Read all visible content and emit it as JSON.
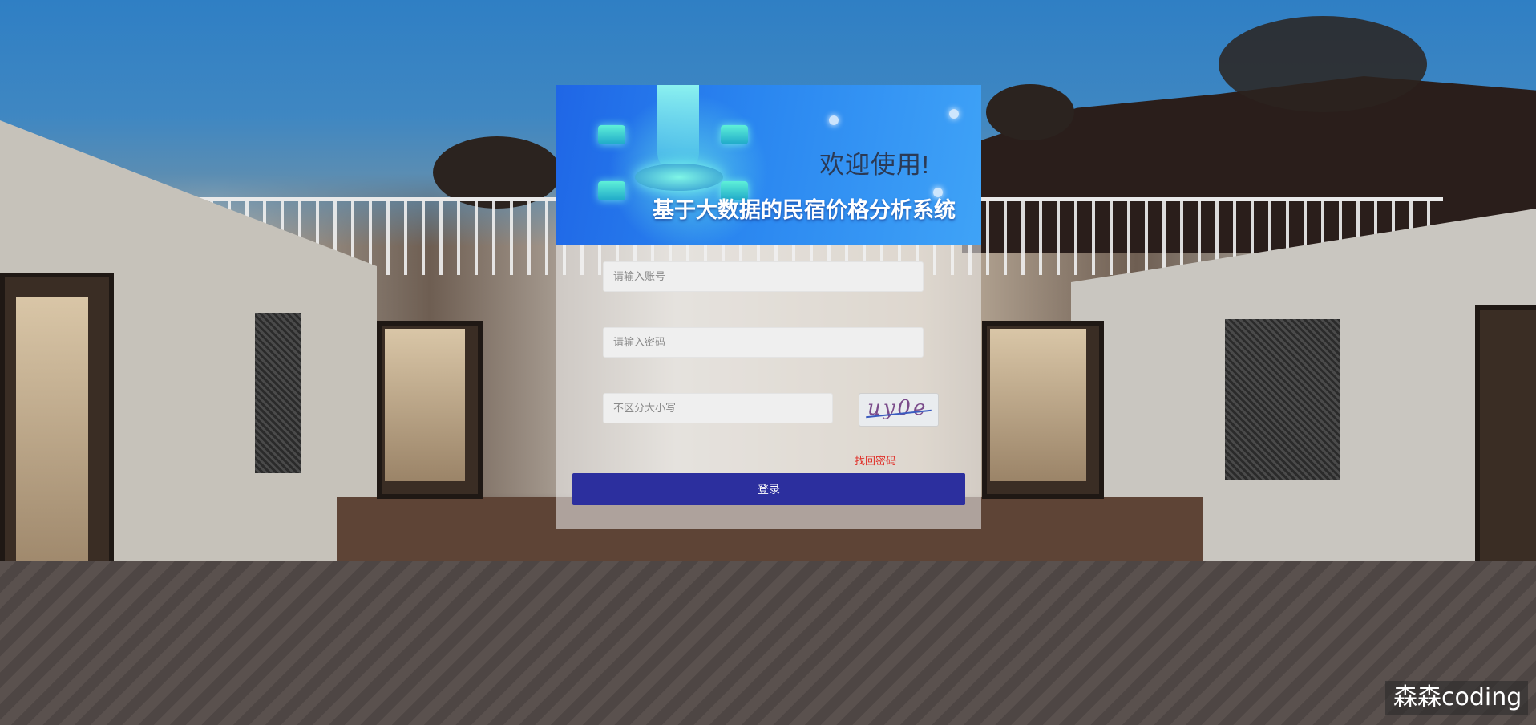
{
  "banner": {
    "welcome": "欢迎使用!",
    "system_title": "基于大数据的民宿价格分析系统"
  },
  "form": {
    "account_placeholder": "请输入账号",
    "password_placeholder": "请输入密码",
    "captcha_placeholder": "不区分大小写",
    "captcha_code": "uy0e",
    "forgot_password": "找回密码",
    "login_button": "登录"
  },
  "watermark": "森森coding",
  "colors": {
    "banner_start": "#1f66e6",
    "banner_end": "#3fa3f7",
    "login_button": "#2c2f9e",
    "forgot_link": "#e0312a"
  }
}
